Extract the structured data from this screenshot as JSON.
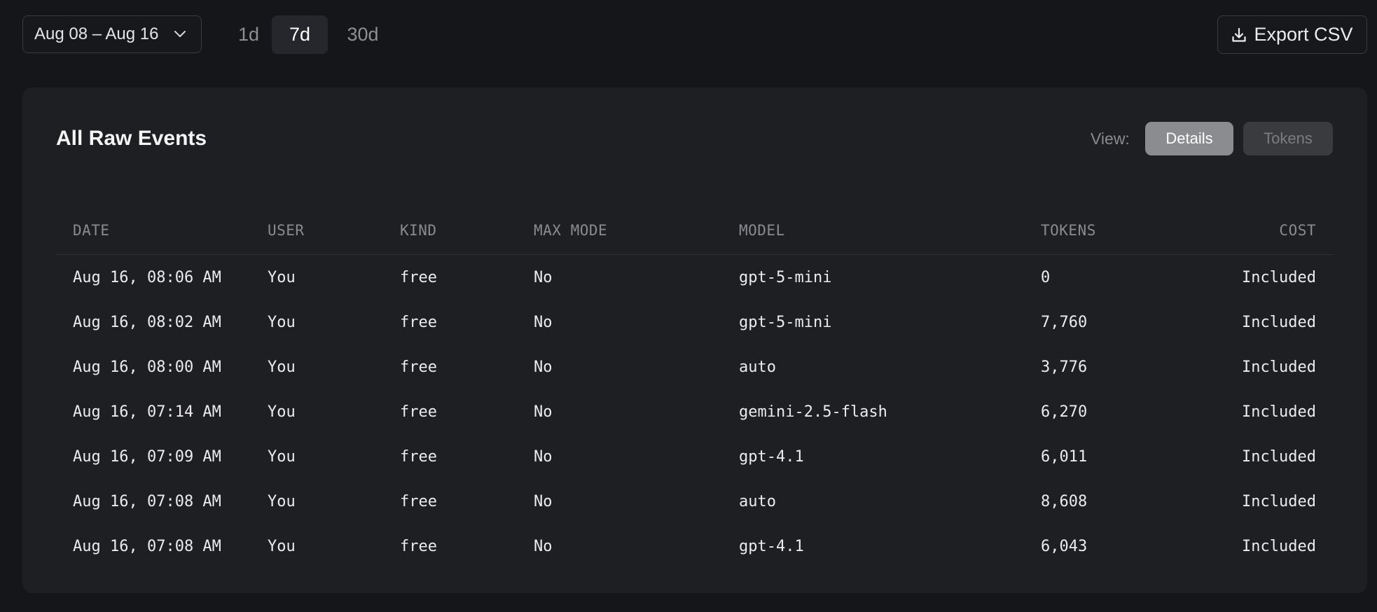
{
  "toolbar": {
    "date_range_label": "Aug 08 – Aug 16",
    "ranges": [
      "1d",
      "7d",
      "30d"
    ],
    "selected_range": "7d",
    "export_label": "Export CSV"
  },
  "card": {
    "title": "All Raw Events",
    "view_label": "View:",
    "view_options": [
      "Details",
      "Tokens"
    ],
    "selected_view": "Details"
  },
  "table": {
    "columns": [
      "DATE",
      "USER",
      "KIND",
      "MAX MODE",
      "MODEL",
      "TOKENS",
      "COST"
    ],
    "rows": [
      {
        "date": "Aug 16, 08:06 AM",
        "user": "You",
        "kind": "free",
        "max_mode": "No",
        "model": "gpt-5-mini",
        "tokens": "0",
        "cost": "Included"
      },
      {
        "date": "Aug 16, 08:02 AM",
        "user": "You",
        "kind": "free",
        "max_mode": "No",
        "model": "gpt-5-mini",
        "tokens": "7,760",
        "cost": "Included"
      },
      {
        "date": "Aug 16, 08:00 AM",
        "user": "You",
        "kind": "free",
        "max_mode": "No",
        "model": "auto",
        "tokens": "3,776",
        "cost": "Included"
      },
      {
        "date": "Aug 16, 07:14 AM",
        "user": "You",
        "kind": "free",
        "max_mode": "No",
        "model": "gemini-2.5-flash",
        "tokens": "6,270",
        "cost": "Included"
      },
      {
        "date": "Aug 16, 07:09 AM",
        "user": "You",
        "kind": "free",
        "max_mode": "No",
        "model": "gpt-4.1",
        "tokens": "6,011",
        "cost": "Included"
      },
      {
        "date": "Aug 16, 07:08 AM",
        "user": "You",
        "kind": "free",
        "max_mode": "No",
        "model": "auto",
        "tokens": "8,608",
        "cost": "Included"
      },
      {
        "date": "Aug 16, 07:08 AM",
        "user": "You",
        "kind": "free",
        "max_mode": "No",
        "model": "gpt-4.1",
        "tokens": "6,043",
        "cost": "Included"
      }
    ]
  },
  "icons": {
    "date_picker": "chevron-down-icon",
    "export": "download-icon"
  },
  "colors": {
    "background": "#15161a",
    "card": "#1e1f23",
    "selected_view": "#8b8c8f"
  }
}
